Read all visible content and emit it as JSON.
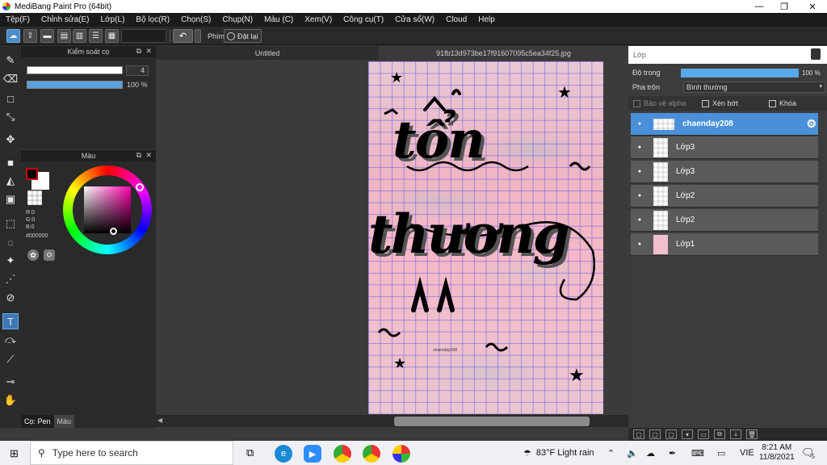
{
  "window": {
    "title": "MediBang Paint Pro (64bit)",
    "minimize": "—",
    "restore": "❐",
    "close": "✕"
  },
  "menu": [
    "Tệp(F)",
    "Chỉnh sửa(E)",
    "Lớp(L)",
    "Bộ lọc(R)",
    "Chọn(S)",
    "Chụp(N)",
    "Màu (C)",
    "Xem(V)",
    "Công cụ(T)",
    "Cửa sổ(W)",
    "Cloud",
    "Help"
  ],
  "toolbar": {
    "key_label": "Phím",
    "reset_label": "Đặt lại",
    "undo_icon": "↶"
  },
  "brush_panel": {
    "title": "Kiểm soát cọ",
    "size_value": "4",
    "opacity_value": "100 %",
    "opacity": 1.0
  },
  "color_panel": {
    "title": "Màu",
    "r": "R:0",
    "g": "G:0",
    "b": "B:0",
    "hex": "#000000",
    "primary_color": "#000000"
  },
  "left_tabs": {
    "pen": "Cọ: Pen",
    "color": "Màu"
  },
  "tabs": [
    "Untitled",
    "91fb13d973be17f91607095c5ea34f25.jpg"
  ],
  "artwork": {
    "line1": "tổn",
    "line2": "thương",
    "small_text": "chaenday208",
    "stars": [
      "★",
      "★",
      "★",
      "★",
      "★"
    ]
  },
  "layer_panel": {
    "title": "Lớp",
    "opacity_label": "Độ trong",
    "opacity_value": "100 %",
    "opacity": 1.0,
    "blend_label": "Pha trộn",
    "blend_value": "Bình thường",
    "protect_alpha": "Bảo vệ alpha",
    "clipping": "Xén bớt",
    "lock": "Khóa",
    "layers": [
      {
        "name": "chaenday208",
        "selected": true
      },
      {
        "name": "Lớp3",
        "selected": false
      },
      {
        "name": "Lớp3",
        "selected": false
      },
      {
        "name": "Lớp2",
        "selected": false
      },
      {
        "name": "Lớp2",
        "selected": false
      },
      {
        "name": "Lớp1",
        "selected": false
      }
    ]
  },
  "taskbar": {
    "search_placeholder": "Type here to search",
    "weather": "83°F  Light rain",
    "lang": "VIE",
    "time": "8:21 AM",
    "date": "11/8/2021",
    "notifications": "5"
  }
}
